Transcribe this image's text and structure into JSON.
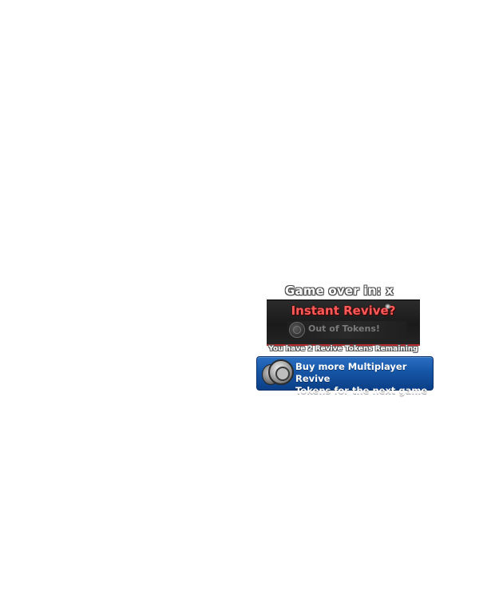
{
  "countdown": {
    "text": "Game over in: x"
  },
  "revive_panel": {
    "title": "Instant Revive?",
    "token_status": "Out of Tokens!",
    "icons": {
      "title_accent": "sparkle-icon",
      "token": "token-coin-icon"
    },
    "accent_color": "#ff5a5a",
    "underline_color": "#b52a2a"
  },
  "remaining": {
    "text": "You have 2 Revive Tokens Remaining"
  },
  "buy_button": {
    "line1": "Buy more Multiplayer Revive",
    "line2": "Tokens for the next game",
    "icon": "coin-stack-icon",
    "color": "#1655a6"
  }
}
